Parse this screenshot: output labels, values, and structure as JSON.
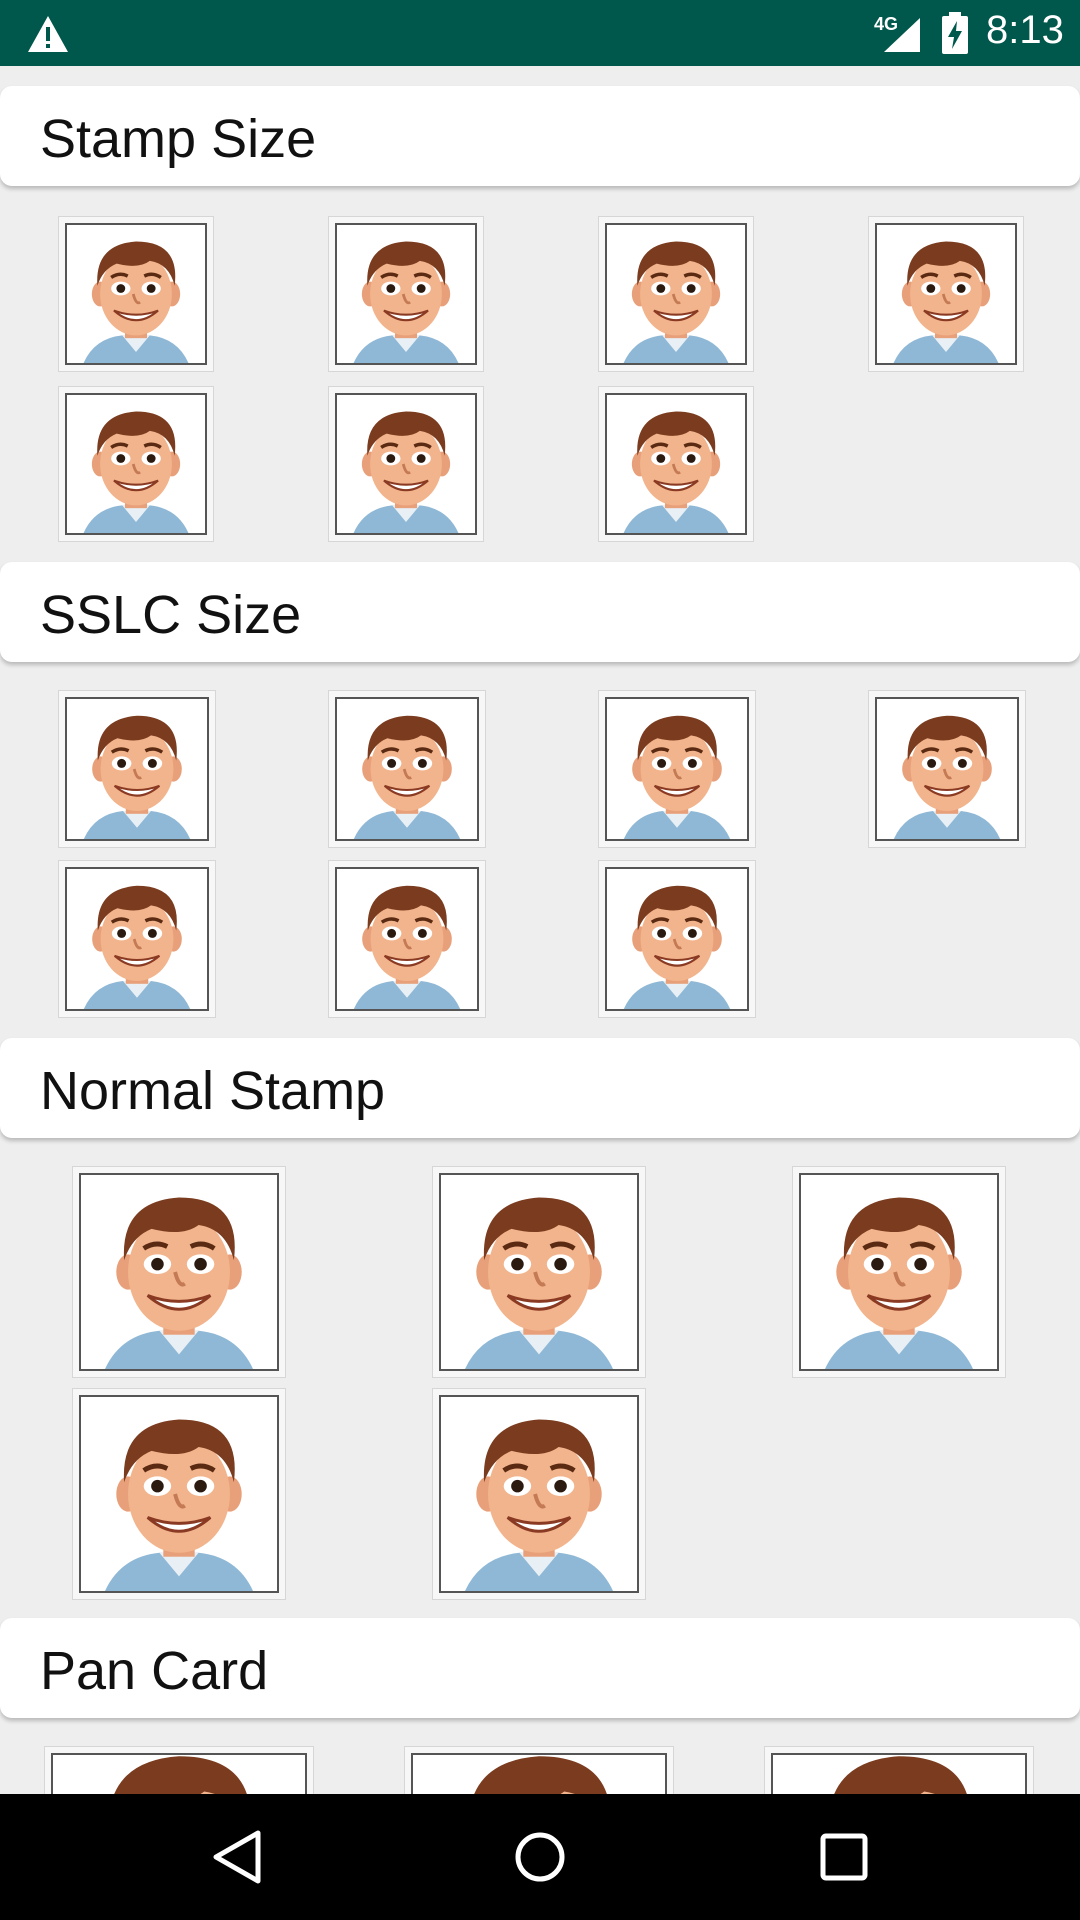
{
  "status_bar": {
    "network": "4G",
    "time": "8:13",
    "icons": [
      "warning-icon",
      "signal-icon",
      "battery-charging-icon"
    ]
  },
  "sections": [
    {
      "title": "Stamp Size",
      "photo_count": 7
    },
    {
      "title": "SSLC Size",
      "photo_count": 7
    },
    {
      "title": "Normal Stamp",
      "photo_count": 5
    },
    {
      "title": "Pan Card",
      "photo_count": 3
    }
  ],
  "photo_alt": "cartoon-face-photo",
  "nav_bar": {
    "icons": [
      "back-icon",
      "home-icon",
      "recents-icon"
    ]
  },
  "colors": {
    "status_bar": "#00574b",
    "background": "#eeeeee",
    "header": "#ffffff",
    "nav_bar": "#000000"
  }
}
